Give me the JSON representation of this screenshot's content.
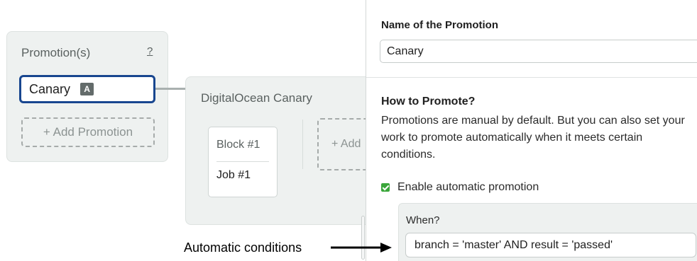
{
  "promotions_panel": {
    "title": "Promotion(s)",
    "help_link": "?",
    "items": [
      {
        "label": "Canary",
        "badge": "A"
      }
    ],
    "add_button": "+ Add Promotion"
  },
  "pipeline": {
    "title": "DigitalOcean Canary",
    "blocks": [
      {
        "name": "Block #1",
        "job": "Job #1"
      }
    ],
    "add_block_label": "+ Add"
  },
  "form": {
    "name_label": "Name of the Promotion",
    "name_value": "Canary",
    "how_title": "How to Promote?",
    "how_description": "Promotions are manual by default. But you can also set your work to promote automatically when it meets certain conditions.",
    "auto_checkbox": {
      "label": "Enable automatic promotion",
      "checked": true
    },
    "when_label": "When?",
    "condition_value": "branch = 'master' AND result = 'passed'"
  },
  "annotation": {
    "text": "Automatic conditions"
  },
  "colors": {
    "selected_border": "#18468f",
    "checkbox_green": "#3aa63a",
    "panel_bg": "#eef1f0"
  },
  "icons": {
    "auto_badge": "auto-promotion-badge",
    "checkbox": "checkmark-icon",
    "arrow": "right-arrow-icon"
  }
}
